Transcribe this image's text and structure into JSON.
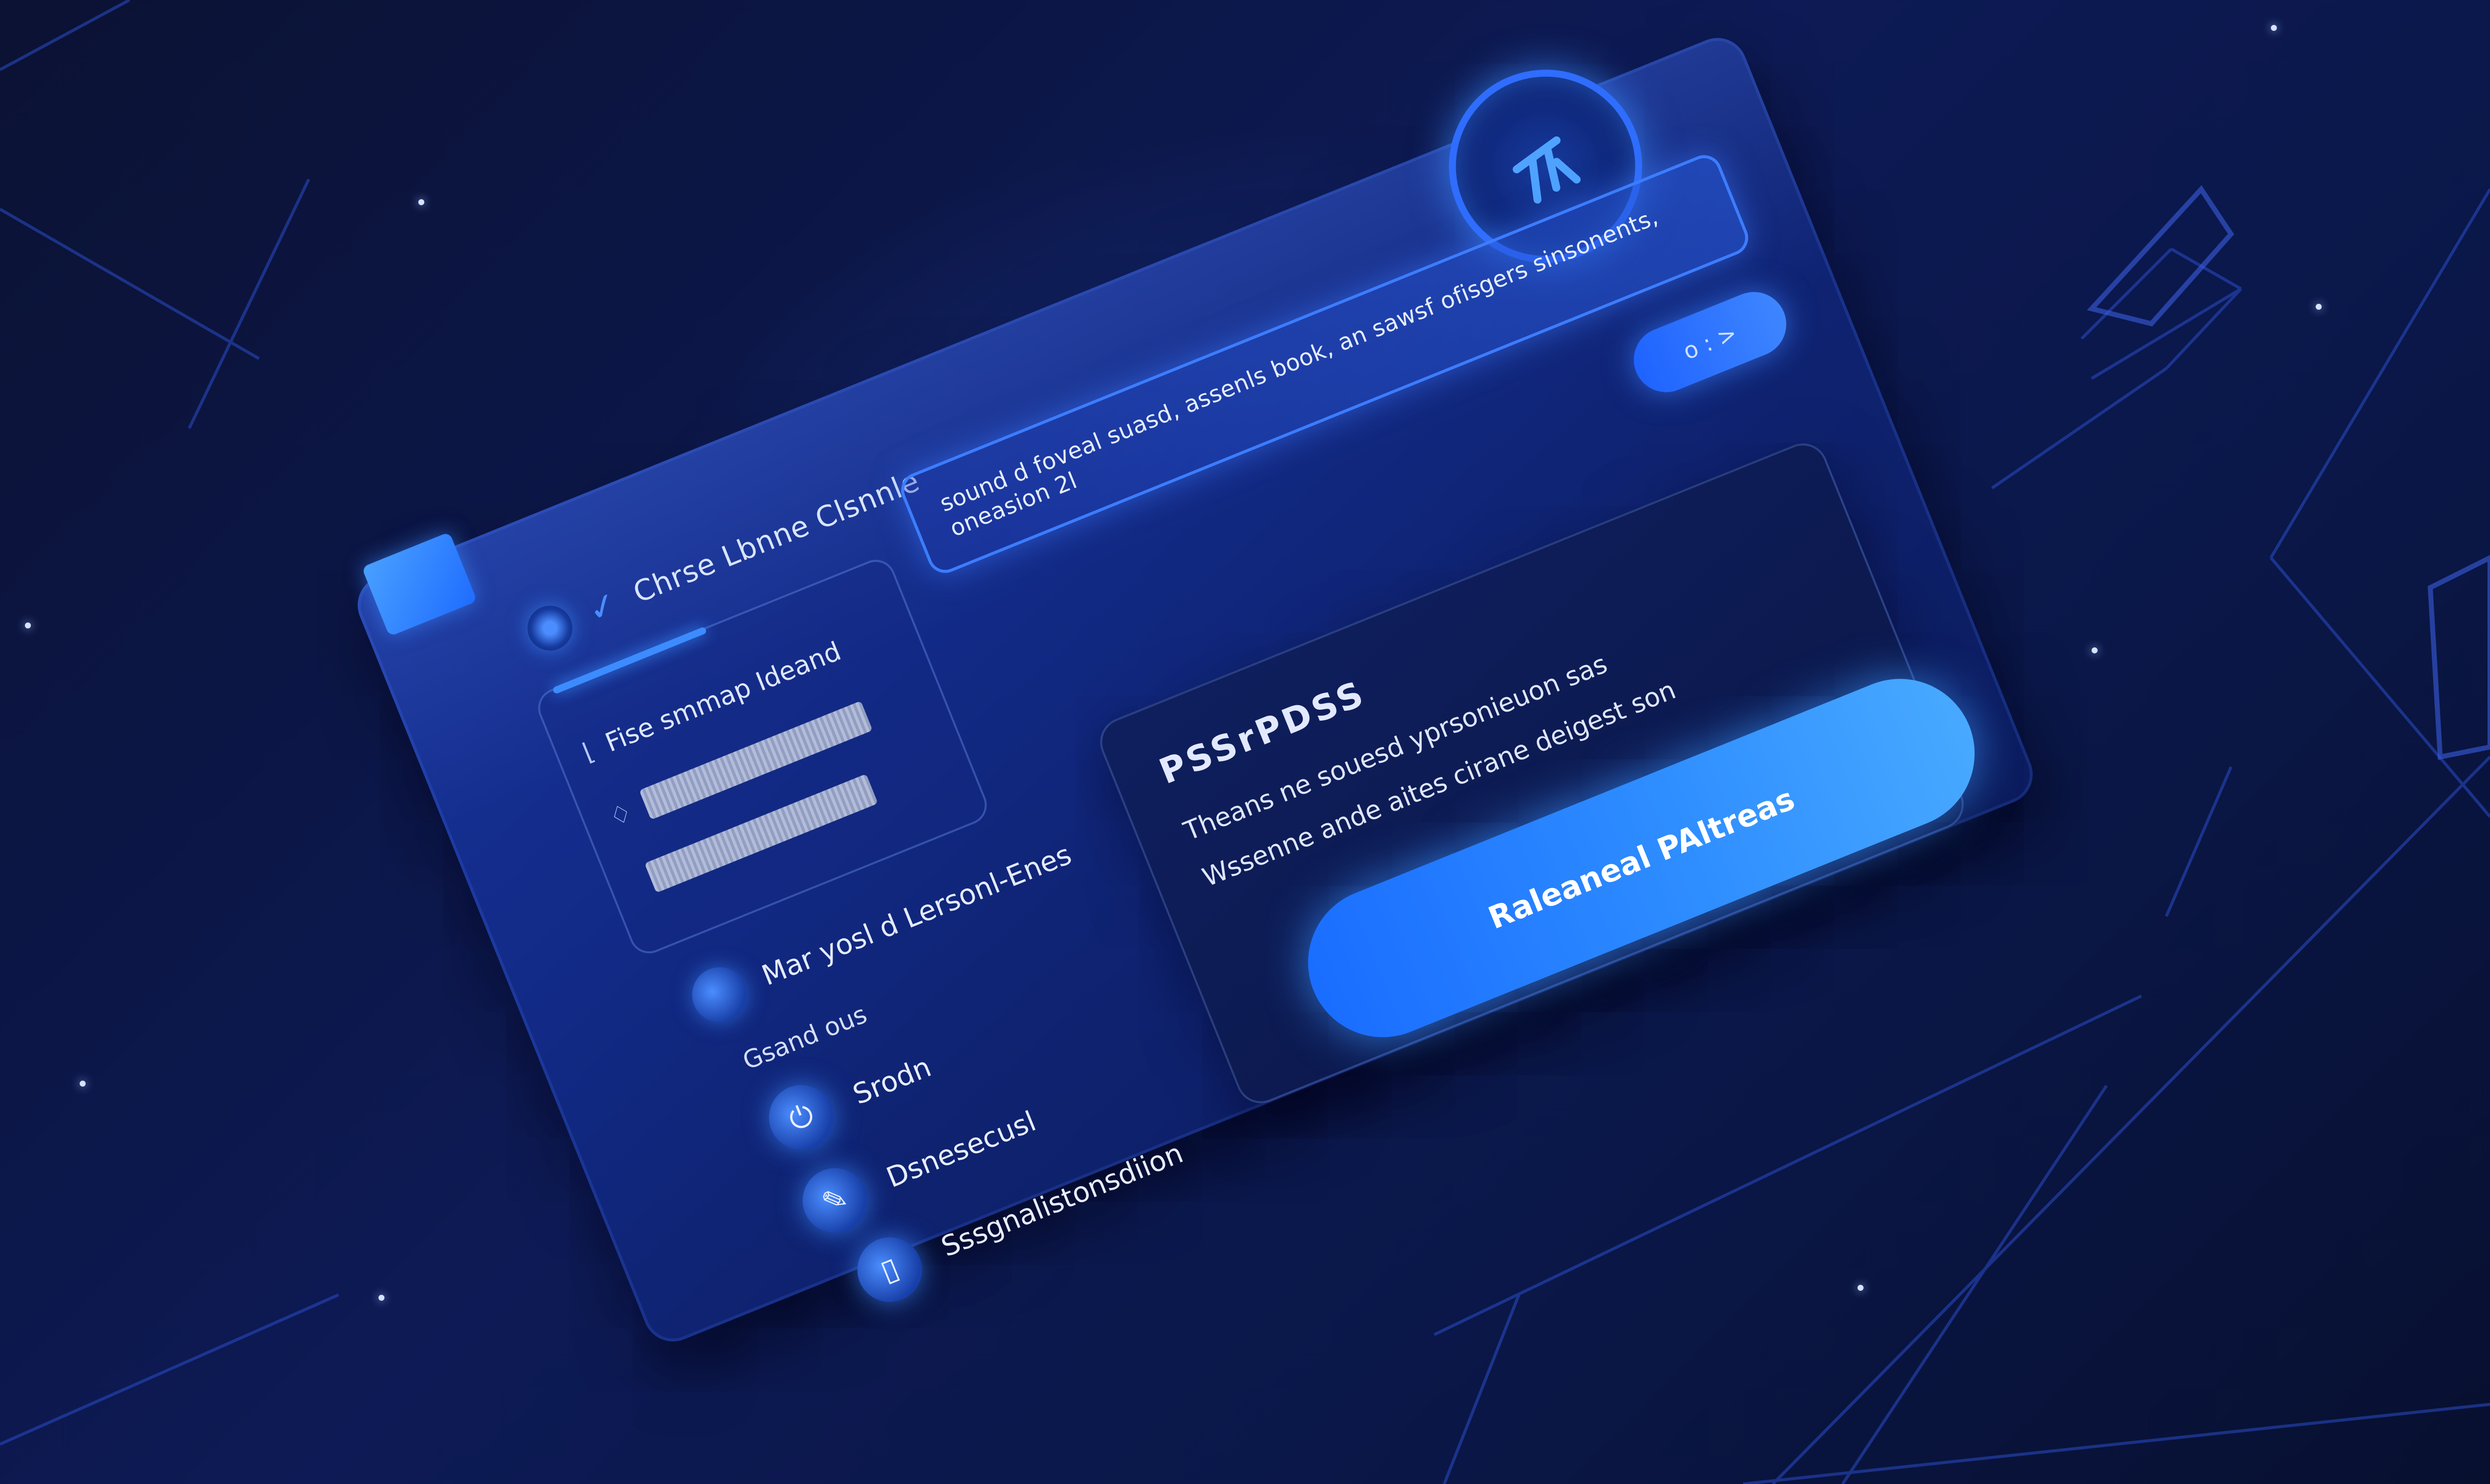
{
  "header": {
    "title": "Chrse Lbnne Clsnnle"
  },
  "url_field": {
    "text": "sound d foveal suasd, assenls book, an sawsf ofisgers sinsonents, oneasion 2l"
  },
  "toggle": {
    "label": "o : >"
  },
  "left_list": {
    "first_row": "Fise smmap Ideand"
  },
  "menu": {
    "heading": "Mar yosl d Lersonl-Enes",
    "section_label": "Gsand ous",
    "items": [
      {
        "label": "Srodn",
        "icon": "power-icon"
      },
      {
        "label": "Dsnesecusl",
        "icon": "pen-icon"
      },
      {
        "label": "Sssgnalistonsdiion",
        "icon": "book-icon"
      }
    ]
  },
  "right_card": {
    "title": "PSSrPDSS",
    "line1": "Theans ne souesd yprsonieuon sas",
    "line2": "Wssenne ande aites cirane deigest son",
    "cta_label": "Raleaneal PAltreas"
  },
  "colors": {
    "accent": "#2e8dff",
    "background": "#0a1440",
    "panel": "#122a86"
  }
}
